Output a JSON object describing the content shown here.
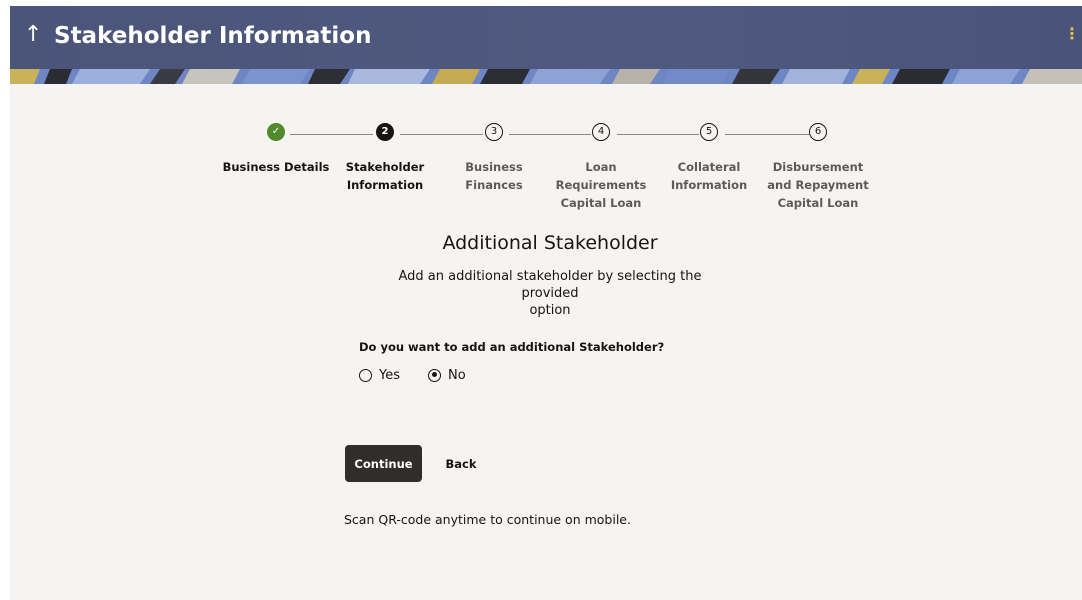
{
  "header": {
    "title": "Stakeholder Information",
    "back_icon": "↑",
    "menu_icon": "⋮"
  },
  "stepper": {
    "steps": [
      {
        "number": "✓",
        "label": "Business Details",
        "state": "done"
      },
      {
        "number": "2",
        "label": "Stakeholder Information",
        "state": "active"
      },
      {
        "number": "3",
        "label": "Business Finances",
        "state": "todo"
      },
      {
        "number": "4",
        "label": "Loan Requirements Capital Loan",
        "state": "todo"
      },
      {
        "number": "5",
        "label": "Collateral Information",
        "state": "todo"
      },
      {
        "number": "6",
        "label": "Disbursement and Repayment Capital Loan",
        "state": "todo"
      }
    ],
    "label_lines": [
      [
        "Business Details"
      ],
      [
        "Stakeholder",
        "Information"
      ],
      [
        "Business",
        "Finances"
      ],
      [
        "Loan",
        "Requirements",
        "Capital Loan"
      ],
      [
        "Collateral",
        "Information"
      ],
      [
        "Disbursement",
        "and Repayment",
        "Capital Loan"
      ]
    ]
  },
  "main": {
    "title": "Additional Stakeholder",
    "description_line1": "Add an additional stakeholder by selecting the provided",
    "description_line2": "option",
    "question": "Do you want to add an additional Stakeholder?",
    "options": [
      {
        "label": "Yes",
        "selected": false
      },
      {
        "label": "No",
        "selected": true
      }
    ]
  },
  "actions": {
    "continue_label": "Continue",
    "back_label": "Back"
  },
  "footer": {
    "qr_text": "Scan QR-code anytime to continue on mobile."
  },
  "colors": {
    "header_bg": "#4f597f",
    "done_step": "#508a2d",
    "primary_button": "#312d2a",
    "page_bg": "#f5f4f2"
  }
}
